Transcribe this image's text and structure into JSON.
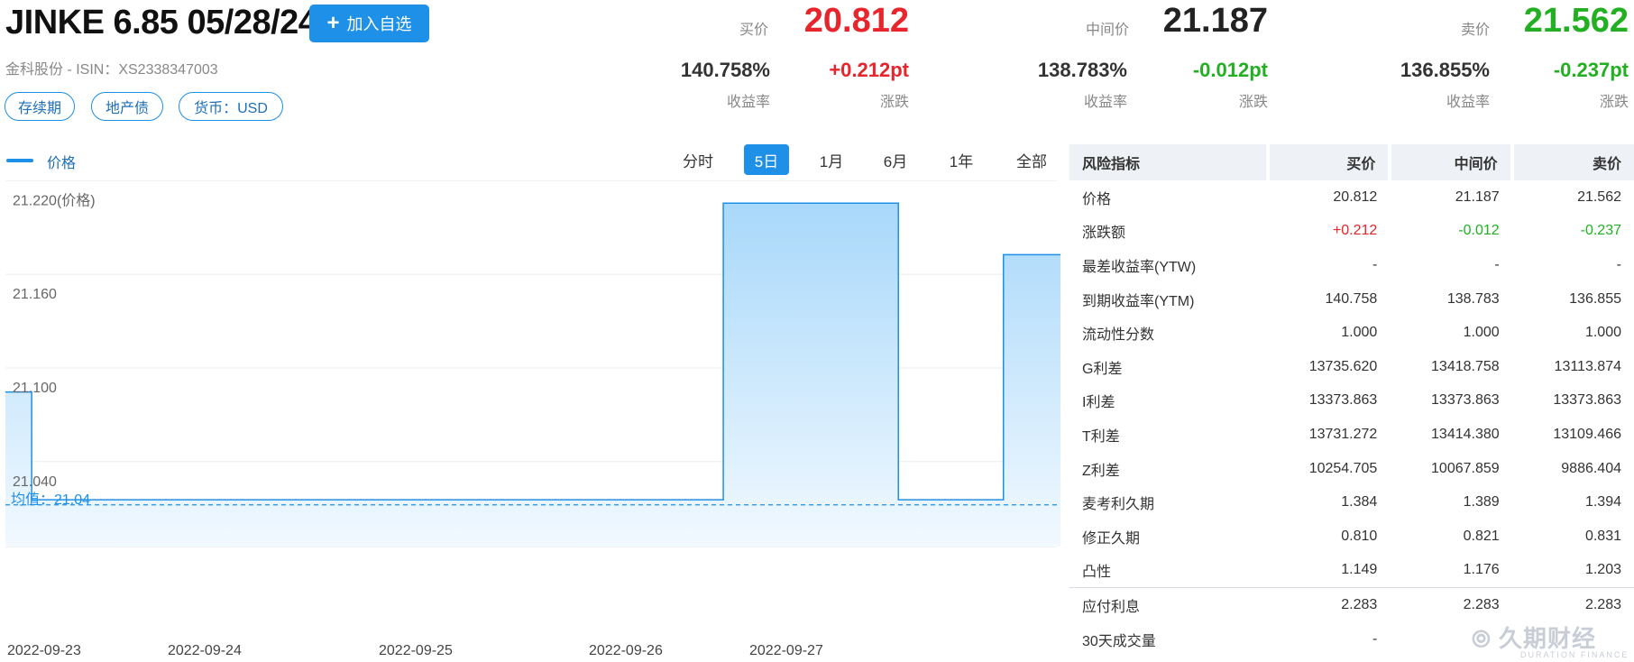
{
  "header": {
    "title": "JINKE 6.85 05/28/24",
    "add_watchlist_label": "加入自选",
    "subtitle": "金科股份 - ISIN：XS2338347003",
    "tags": [
      "存续期",
      "地产债",
      "货币：USD"
    ]
  },
  "quotes": {
    "bid": {
      "label": "买价",
      "price": "20.812",
      "yield": "140.758%",
      "yield_label": "收益率",
      "change": "+0.212pt",
      "change_label": "涨跌"
    },
    "mid": {
      "label": "中间价",
      "price": "21.187",
      "yield": "138.783%",
      "yield_label": "收益率",
      "change": "-0.012pt",
      "change_label": "涨跌"
    },
    "ask": {
      "label": "卖价",
      "price": "21.562",
      "yield": "136.855%",
      "yield_label": "收益率",
      "change": "-0.237pt",
      "change_label": "涨跌"
    }
  },
  "chart": {
    "legend": "价格",
    "range_tabs": [
      "分时",
      "5日",
      "1月",
      "6月",
      "1年",
      "全部"
    ],
    "active_tab": "5日"
  },
  "chart_data": {
    "type": "area",
    "step": true,
    "series": [
      {
        "name": "价格",
        "points": [
          {
            "x": "2022-09-23",
            "y": 21.099
          },
          {
            "x": "2022-09-23 03:00",
            "y": 21.03
          },
          {
            "x": "2022-09-26 10:00",
            "y": 21.22
          },
          {
            "x": "2022-09-27 06:00",
            "y": 21.03
          },
          {
            "x": "2022-09-27 18:00",
            "y": 21.187
          },
          {
            "x": "2022-09-28 02:00",
            "y": 21.187
          }
        ]
      }
    ],
    "y_ticks": [
      "21.220(价格)",
      "21.160",
      "21.100",
      "21.040"
    ],
    "y_tick_values": [
      21.22,
      21.16,
      21.1,
      21.04
    ],
    "x_ticks": [
      "2022-09-23",
      "2022-09-24",
      "2022-09-25",
      "2022-09-26",
      "2022-09-27"
    ],
    "ylim": [
      21.0,
      21.23
    ],
    "average_label": "均值：21.04",
    "average_value": 21.04,
    "colors": {
      "line": "#1e90e8",
      "fill_top": "#a8d8fa",
      "fill_bottom": "#f2f9ff",
      "avg": "#1e90e8"
    },
    "grid": true
  },
  "risk_table": {
    "headers": [
      "风险指标",
      "买价",
      "中间价",
      "卖价"
    ],
    "rows": [
      [
        "价格",
        "20.812",
        "21.187",
        "21.562"
      ],
      [
        "涨跌额",
        "+0.212",
        "-0.012",
        "-0.237"
      ],
      [
        "最差收益率(YTW)",
        "-",
        "-",
        "-"
      ],
      [
        "到期收益率(YTM)",
        "140.758",
        "138.783",
        "136.855"
      ],
      [
        "流动性分数",
        "1.000",
        "1.000",
        "1.000"
      ],
      [
        "G利差",
        "13735.620",
        "13418.758",
        "13113.874"
      ],
      [
        "I利差",
        "13373.863",
        "13373.863",
        "13373.863"
      ],
      [
        "T利差",
        "13731.272",
        "13414.380",
        "13109.466"
      ],
      [
        "Z利差",
        "10254.705",
        "10067.859",
        "9886.404"
      ],
      [
        "麦考利久期",
        "1.384",
        "1.389",
        "1.394"
      ],
      [
        "修正久期",
        "0.810",
        "0.821",
        "0.831"
      ],
      [
        "凸性",
        "1.149",
        "1.176",
        "1.203"
      ],
      [
        "应付利息",
        "2.283",
        "2.283",
        "2.283"
      ],
      [
        "30天成交量",
        "-",
        "",
        ""
      ]
    ]
  },
  "watermark": {
    "main": "久期财经",
    "sub": "DURATION FINANCE"
  },
  "colors": {
    "accent": "#1e90e8",
    "up": "#e8242c",
    "down": "#22b022"
  }
}
